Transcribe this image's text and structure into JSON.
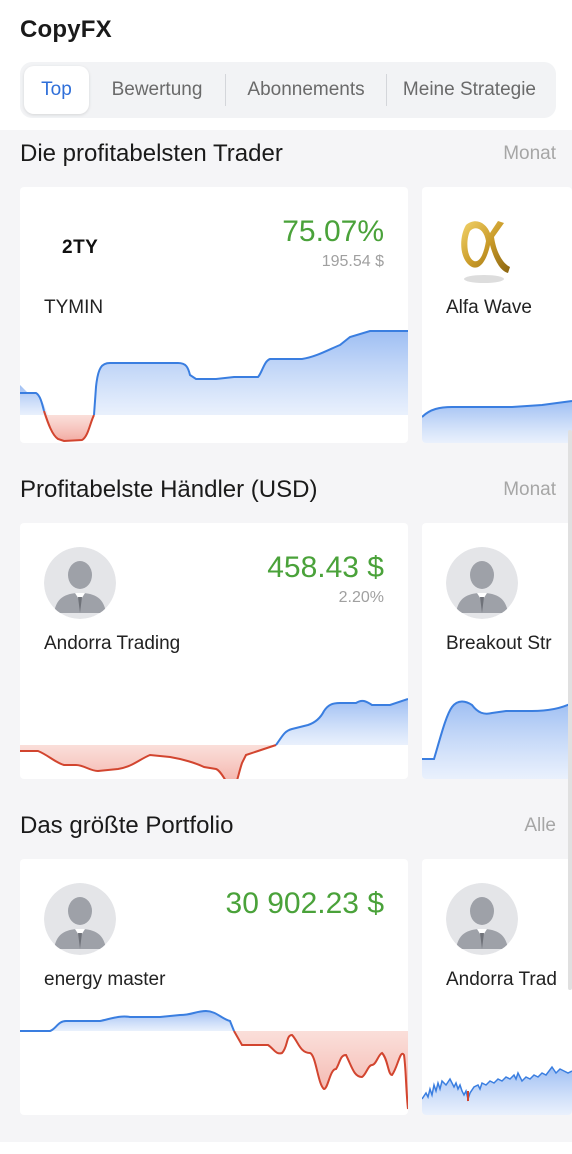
{
  "app": {
    "title": "CopyFX"
  },
  "tabs": [
    {
      "label": "Top",
      "active": true
    },
    {
      "label": "Bewertung",
      "active": false
    },
    {
      "label": "Abonnements",
      "active": false
    },
    {
      "label": "Meine Strategie",
      "active": false
    }
  ],
  "sections": [
    {
      "title": "Die profitabelsten Trader",
      "link": "Monat",
      "cards": [
        {
          "name": "TYMIN",
          "logo_text": "2TY",
          "value": "75.07%",
          "sub": "195.54 $"
        },
        {
          "name": "Alfa Wave",
          "logo": "alfa-logo"
        }
      ]
    },
    {
      "title": "Profitabelste Händler (USD)",
      "link": "Monat",
      "cards": [
        {
          "name": "Andorra Trading",
          "value": "458.43 $",
          "sub": "2.20%"
        },
        {
          "name": "Breakout Str"
        }
      ]
    },
    {
      "title": "Das größte Portfolio",
      "link": "Alle",
      "cards": [
        {
          "name": "energy master",
          "value": "30 902.23 $"
        },
        {
          "name": "Andorra Trad"
        }
      ]
    }
  ],
  "colors": {
    "accent": "#2f6fd9",
    "positive": "#4aa23a",
    "line_up": "#3a7ee0",
    "line_down": "#d2452f"
  }
}
